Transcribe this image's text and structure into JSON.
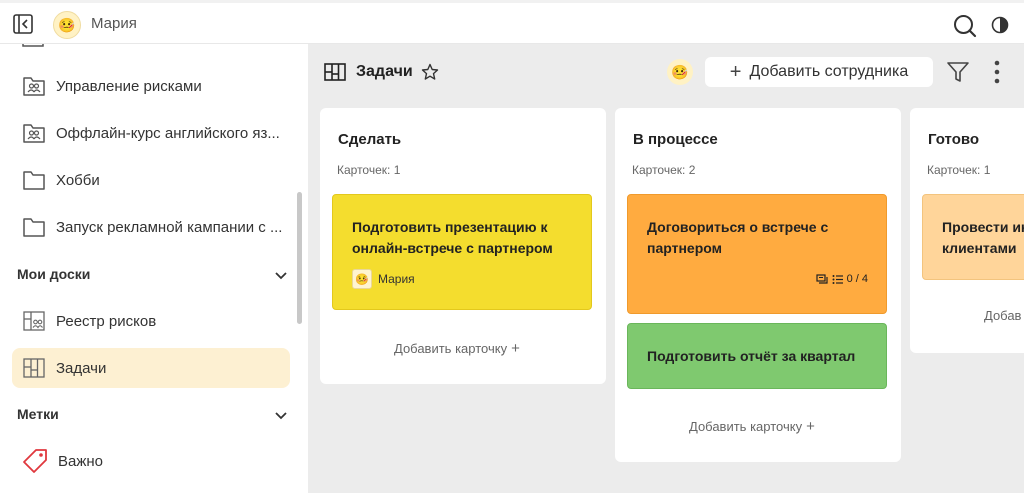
{
  "user": {
    "name": "Мария"
  },
  "sidebar": {
    "items": [
      {
        "label": "Управление рисками"
      },
      {
        "label": "Оффлайн-курс английского яз..."
      },
      {
        "label": "Хобби"
      },
      {
        "label": "Запуск рекламной кампании с ..."
      }
    ],
    "boards_header": "Мои доски",
    "boards": [
      {
        "label": "Реестр рисков"
      },
      {
        "label": "Задачи"
      }
    ],
    "tags_header": "Метки",
    "tags": [
      {
        "label": "Важно"
      }
    ]
  },
  "board": {
    "title": "Задачи",
    "add_employee": "Добавить сотрудника"
  },
  "columns": [
    {
      "title": "Сделать",
      "count": "Карточек: 1",
      "add_card": "Добавить карточку",
      "cards": [
        {
          "title": "Подготовить презентацию к онлайн-встрече с партнером",
          "assignee": "Мария",
          "color": "#f4dd2e"
        }
      ]
    },
    {
      "title": "В процессе",
      "count": "Карточек: 2",
      "add_card": "Добавить карточку",
      "cards": [
        {
          "title": "Договориться о встрече с партнером",
          "checklist": "0 / 4",
          "color": "#ffab40"
        },
        {
          "title": "Подготовить отчёт за квартал",
          "color": "#7fc96f"
        }
      ]
    },
    {
      "title": "Готово",
      "count": "Карточек: 1",
      "add_card": "Добав",
      "cards": [
        {
          "title": "Провести ин клиентами",
          "color": "#ffd59a"
        }
      ]
    }
  ],
  "icons": {
    "sidebar_toggle": "sidebar-collapse-icon",
    "search": "search-icon",
    "theme": "theme-toggle-icon",
    "board": "board-icon",
    "star": "star-icon",
    "filter": "filter-icon",
    "more": "more-vertical-icon",
    "tag": "tag-icon"
  }
}
